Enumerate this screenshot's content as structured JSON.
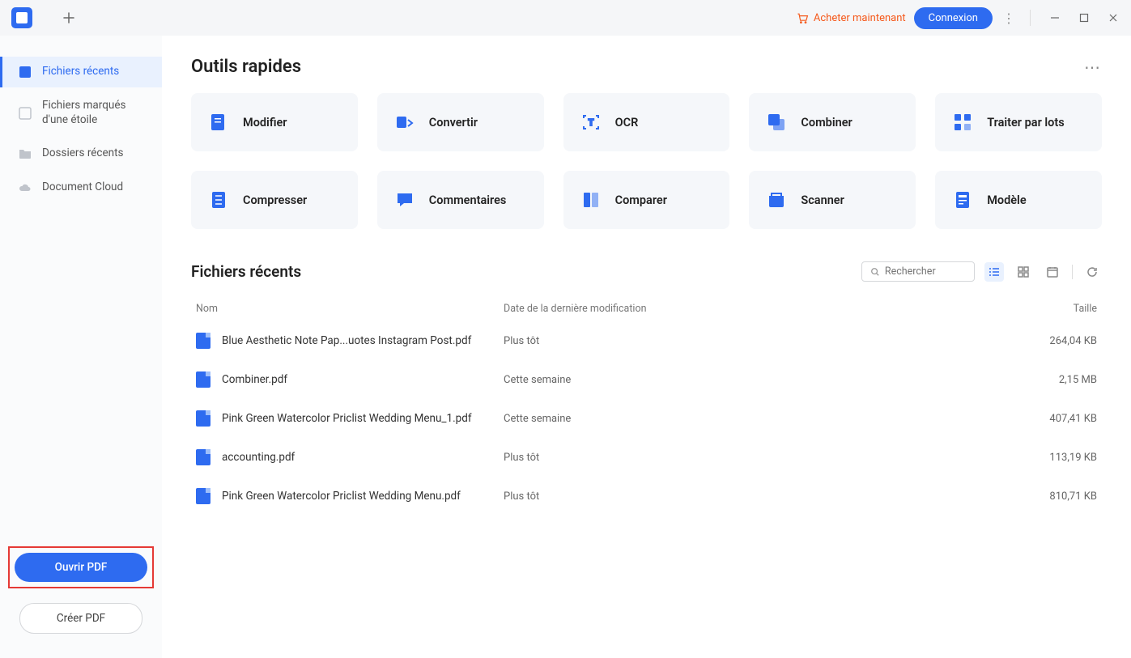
{
  "titlebar": {
    "buy_now": "Acheter maintenant",
    "login": "Connexion"
  },
  "sidebar": {
    "items": [
      {
        "label": "Fichiers récents",
        "active": true
      },
      {
        "label": "Fichiers marqués d'une étoile"
      },
      {
        "label": "Dossiers récents"
      },
      {
        "label": "Document Cloud"
      }
    ],
    "open_pdf": "Ouvrir PDF",
    "create_pdf": "Créer PDF"
  },
  "quick_tools": {
    "title": "Outils rapides",
    "tools": [
      {
        "label": "Modifier",
        "icon": "edit"
      },
      {
        "label": "Convertir",
        "icon": "convert"
      },
      {
        "label": "OCR",
        "icon": "ocr"
      },
      {
        "label": "Combiner",
        "icon": "combine"
      },
      {
        "label": "Traiter par lots",
        "icon": "batch"
      },
      {
        "label": "Compresser",
        "icon": "compress"
      },
      {
        "label": "Commentaires",
        "icon": "comment"
      },
      {
        "label": "Comparer",
        "icon": "compare"
      },
      {
        "label": "Scanner",
        "icon": "scan"
      },
      {
        "label": "Modèle",
        "icon": "template"
      }
    ]
  },
  "recent": {
    "title": "Fichiers récents",
    "search_placeholder": "Rechercher",
    "columns": {
      "name": "Nom",
      "date": "Date de la dernière modification",
      "size": "Taille"
    },
    "files": [
      {
        "name": "Blue Aesthetic Note Pap...uotes Instagram Post.pdf",
        "date": "Plus tôt",
        "size": "264,04 KB"
      },
      {
        "name": "Combiner.pdf",
        "date": "Cette semaine",
        "size": "2,15 MB"
      },
      {
        "name": "Pink Green Watercolor Priclist Wedding Menu_1.pdf",
        "date": "Cette semaine",
        "size": "407,41 KB"
      },
      {
        "name": "accounting.pdf",
        "date": "Plus tôt",
        "size": "113,19 KB"
      },
      {
        "name": "Pink Green Watercolor Priclist Wedding Menu.pdf",
        "date": "Plus tôt",
        "size": "810,71 KB"
      }
    ]
  }
}
